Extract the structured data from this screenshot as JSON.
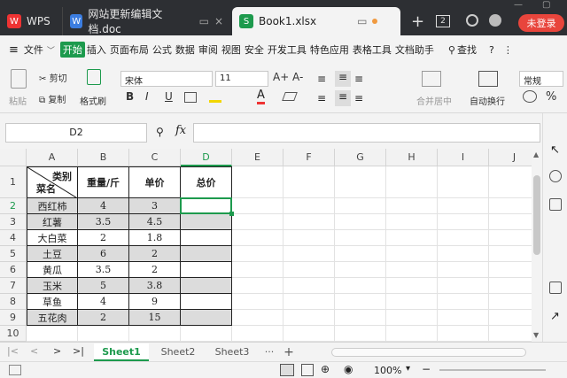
{
  "titlebar": {
    "tabs": [
      {
        "label": "WPS",
        "icon": "wps-logo-icon"
      },
      {
        "label": "网站更新编辑文档.doc",
        "icon": "word-doc-icon"
      },
      {
        "label": "Book1.xlsx",
        "icon": "spreadsheet-icon"
      }
    ],
    "tab_count": "2",
    "login": "未登录"
  },
  "menubar": {
    "file": "文件",
    "items": [
      "开始",
      "插入",
      "页面布局",
      "公式",
      "数据",
      "审阅",
      "视图",
      "安全",
      "开发工具",
      "特色应用",
      "表格工具",
      "文档助手"
    ],
    "search": "查找"
  },
  "ribbon": {
    "paste": "粘贴",
    "cut": "剪切",
    "copy": "复制",
    "format_painter": "格式刷",
    "font_name": "宋体",
    "font_size": "11",
    "merge_center": "合并居中",
    "wrap_text": "自动换行",
    "number_format": "常规",
    "bold": "B",
    "italic": "I",
    "underline": "U",
    "font_color_letter": "A",
    "grow_font": "A+",
    "shrink_font": "A-"
  },
  "formula_bar": {
    "cell_ref": "D2",
    "fx": "fx",
    "value": ""
  },
  "sheet": {
    "columns": [
      "A",
      "B",
      "C",
      "D",
      "E",
      "F",
      "G",
      "H",
      "I",
      "J"
    ],
    "rows": [
      "1",
      "2",
      "3",
      "4",
      "5",
      "6",
      "7",
      "8",
      "9",
      "10",
      "11"
    ],
    "header_top": "类别",
    "header_bottom": "菜名",
    "col_headers": [
      "重量/斤",
      "单价",
      "总价"
    ],
    "data": [
      [
        "西红柿",
        "4",
        "3",
        ""
      ],
      [
        "红薯",
        "3.5",
        "4.5",
        ""
      ],
      [
        "大白菜",
        "2",
        "1.8",
        ""
      ],
      [
        "土豆",
        "6",
        "2",
        ""
      ],
      [
        "黄瓜",
        "3.5",
        "2",
        ""
      ],
      [
        "玉米",
        "5",
        "3.8",
        ""
      ],
      [
        "草鱼",
        "4",
        "9",
        ""
      ],
      [
        "五花肉",
        "2",
        "15",
        ""
      ]
    ],
    "selected_cell": "D2",
    "colors": {
      "accent": "#1d9a4d",
      "row_shade": "#dcdcdc"
    }
  },
  "sheet_tabs": {
    "tabs": [
      "Sheet1",
      "Sheet2",
      "Sheet3"
    ],
    "active": "Sheet1",
    "more": "···",
    "add": "+"
  },
  "statusbar": {
    "zoom": "100%"
  }
}
